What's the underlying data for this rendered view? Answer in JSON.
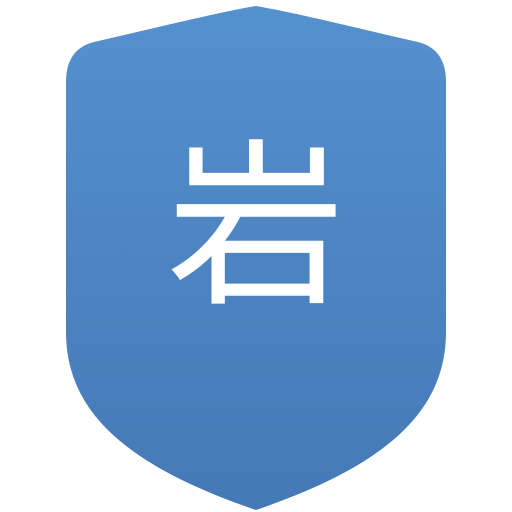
{
  "icon": {
    "name": "shield-icon",
    "glyph": "岩",
    "colors": {
      "shield_top": "#5590cf",
      "shield_bottom": "#4479b5",
      "glyph": "#ffffff",
      "background": "#ffffff"
    }
  }
}
